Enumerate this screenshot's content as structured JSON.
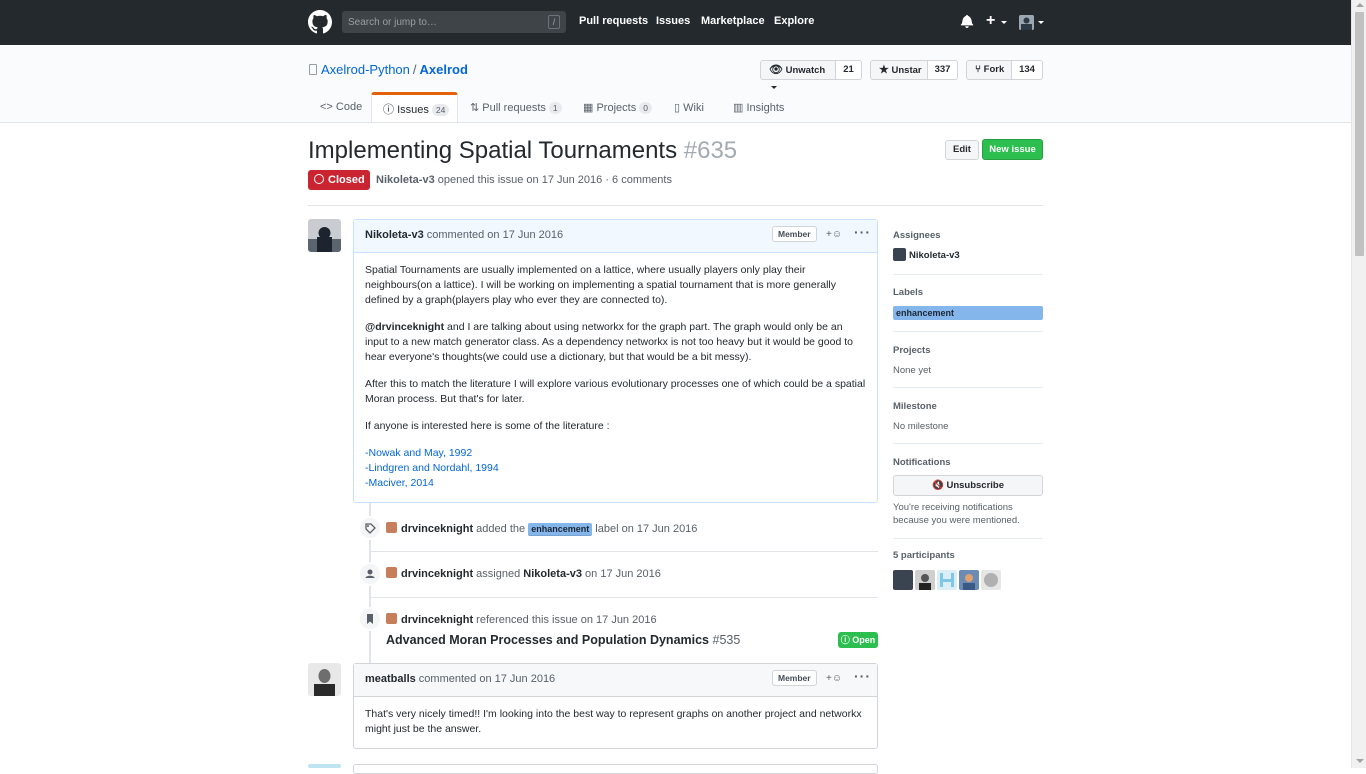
{
  "header": {
    "logo_icon": "github-octocat-icon",
    "search_placeholder": "Search or jump to…",
    "search_shortcut": "/",
    "nav": [
      "Pull requests",
      "Issues",
      "Marketplace",
      "Explore"
    ],
    "plus_label": "+"
  },
  "repo": {
    "owner": "Axelrod-Python",
    "separator": "/",
    "name": "Axelrod",
    "watch_label": "Unwatch",
    "watch_count": "21",
    "star_label": "Unstar",
    "star_count": "337",
    "fork_label": "Fork",
    "fork_count": "134"
  },
  "tabs": [
    {
      "label": "Code"
    },
    {
      "label": "Issues",
      "count": "24"
    },
    {
      "label": "Pull requests",
      "count": "1"
    },
    {
      "label": "Projects",
      "count": "0"
    },
    {
      "label": "Wiki"
    },
    {
      "label": "Insights"
    }
  ],
  "issue": {
    "title": "Implementing Spatial Tournaments",
    "number": "#635",
    "state": "Closed",
    "author": "Nikoleta-v3",
    "meta": " opened this issue on 17 Jun 2016 · 6 comments",
    "edit_label": "Edit",
    "new_issue_label": "New issue"
  },
  "comment1": {
    "author": "Nikoleta-v3",
    "when": " commented on 17 Jun 2016",
    "role": "Member",
    "reaction": "+☺",
    "menu": "···",
    "p1": "Spatial Tournaments are usually implemented on a lattice, where usually players only play their neighbours(on a lattice). I will be working on implementing a spatial tournament that is more generally defined by a graph(players play who ever they are connected to).",
    "p2_mention": "@drvinceknight",
    "p2_rest": " and I are talking about using networkx for the graph part. The graph would only be an input to a new match generator class. As a dependency networkx is not too heavy but it would be good to hear everyone's thoughts(we could use a dictionary, but that would be a bit messy).",
    "p3": "After this to match the literature I will explore various evolutionary processes one of which could be a spatial Moran process. But that's for later.",
    "p4": "If anyone is interested here is some of the literature :",
    "links": [
      "-Nowak and May, 1992",
      "-Lindgren and Nordahl, 1994",
      "-Maciver, 2014"
    ]
  },
  "events": {
    "label_event": {
      "actor": "drvinceknight",
      "pre": " added the ",
      "label": "enhancement",
      "post": " label on 17 Jun 2016"
    },
    "assign_event": {
      "actor": "drvinceknight",
      "pre": " assigned ",
      "assignee": "Nikoleta-v3",
      "post": " on 17 Jun 2016"
    },
    "ref_event": {
      "actor": "drvinceknight",
      "post": " referenced this issue on 17 Jun 2016",
      "ref_title": "Advanced Moran Processes and Population Dynamics",
      "ref_number": "#535",
      "ref_state": "Open"
    }
  },
  "comment2": {
    "author": "meatballs",
    "when": " commented on 17 Jun 2016",
    "role": "Member",
    "reaction": "+☺",
    "menu": "···",
    "body": "That's very nicely timed!! I'm looking into the best way to represent graphs on another project and networkx might just be the answer."
  },
  "sidebar": {
    "assignees_h": "Assignees",
    "assignee": "Nikoleta-v3",
    "labels_h": "Labels",
    "label": "enhancement",
    "projects_h": "Projects",
    "projects_v": "None yet",
    "milestone_h": "Milestone",
    "milestone_v": "No milestone",
    "notif_h": "Notifications",
    "unsub_label": "Unsubscribe",
    "notif_reason": "You're receiving notifications because you were mentioned.",
    "participants_h": "5 participants"
  },
  "colors": {
    "header_bg": "#24292e",
    "closed_red": "#cb2431",
    "open_green": "#2cbe4e",
    "label_blue": "#84b6eb",
    "link_blue": "#0366d6"
  }
}
